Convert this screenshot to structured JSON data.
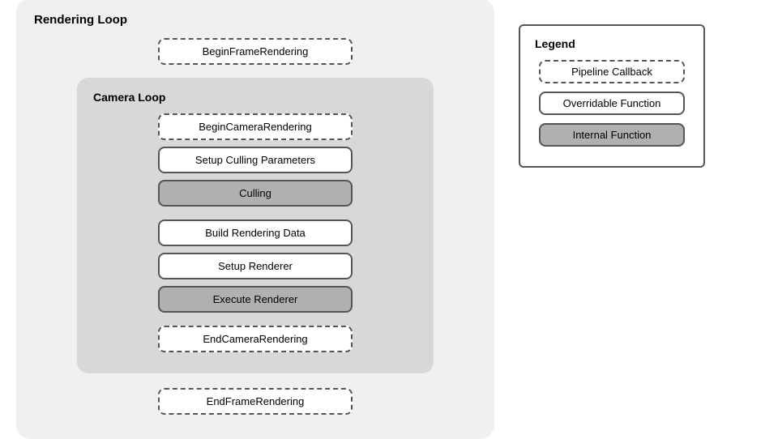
{
  "rendering_loop": {
    "title": "Rendering Loop",
    "begin_frame": "BeginFrameRendering",
    "end_frame": "EndFrameRendering",
    "camera_loop": {
      "title": "Camera Loop",
      "nodes": [
        {
          "label": "BeginCameraRendering",
          "type": "pipeline"
        },
        {
          "label": "Setup Culling Parameters",
          "type": "overridable"
        },
        {
          "label": "Culling",
          "type": "internal"
        },
        {
          "label": "Build Rendering Data",
          "type": "overridable"
        },
        {
          "label": "Setup Renderer",
          "type": "overridable"
        },
        {
          "label": "Execute Renderer",
          "type": "internal"
        },
        {
          "label": "EndCameraRendering",
          "type": "pipeline"
        }
      ]
    }
  },
  "legend": {
    "title": "Legend",
    "items": [
      {
        "label": "Pipeline Callback",
        "type": "pipeline"
      },
      {
        "label": "Overridable Function",
        "type": "overridable"
      },
      {
        "label": "Internal Function",
        "type": "internal"
      }
    ]
  }
}
